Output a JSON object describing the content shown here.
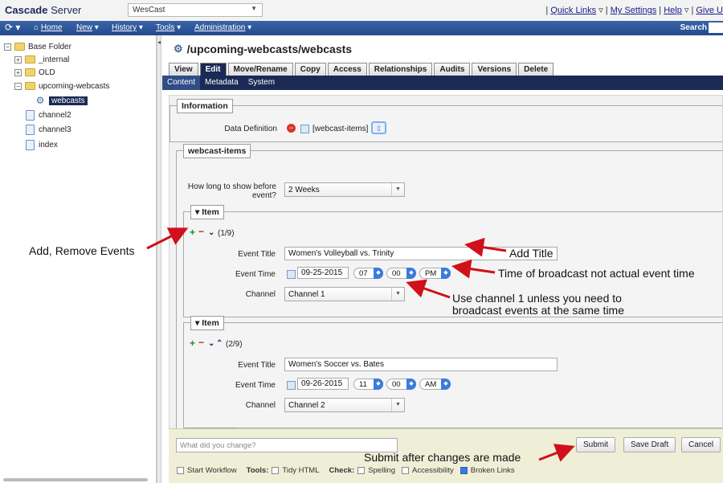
{
  "header": {
    "logo_bold": "Cascade",
    "logo_rest": " Server",
    "site": "WesCast",
    "links": {
      "sep1": "| ",
      "quick_links": "Quick Links",
      "sep2": " ▿ | ",
      "my_settings": "My Settings",
      "sep3": " | ",
      "help": "Help",
      "sep4": " ▿ | ",
      "give": "Give U"
    }
  },
  "nav": {
    "home": "Home",
    "new": "New",
    "history": "History",
    "tools": "Tools",
    "administration": "Administration",
    "search": "Search"
  },
  "tree": {
    "base_folder": "Base Folder",
    "internal": "_internal",
    "old": "OLD",
    "upcoming": "upcoming-webcasts",
    "webcasts": "webcasts",
    "channel2": "channel2",
    "channel3": "channel3",
    "index": "index"
  },
  "page": {
    "title": "/upcoming-webcasts/webcasts",
    "tabs": [
      "View",
      "Edit",
      "Move/Rename",
      "Copy",
      "Access",
      "Relationships",
      "Audits",
      "Versions",
      "Delete"
    ],
    "subtabs": [
      "Content",
      "Metadata",
      "System"
    ]
  },
  "form": {
    "information_legend": "Information",
    "data_definition_label": "Data Definition",
    "data_definition_value": "[webcast-items]",
    "webcast_items_legend": "webcast-items",
    "show_before_label_1": "How long to show before",
    "show_before_label_2": "event?",
    "show_before_value": "2 Weeks",
    "item_legend": "Item",
    "event_title_label": "Event Title",
    "event_time_label": "Event Time",
    "channel_label": "Channel",
    "items": [
      {
        "counter": "(1/9)",
        "title": "Women's Volleyball vs. Trinity",
        "date": "09-25-2015",
        "hour": "07",
        "minute": "00",
        "ampm": "PM",
        "channel": "Channel 1"
      },
      {
        "counter": "(2/9)",
        "title": "Women's Soccer vs. Bates",
        "date": "09-26-2015",
        "hour": "11",
        "minute": "00",
        "ampm": "AM",
        "channel": "Channel 2"
      }
    ]
  },
  "annotations": {
    "add_remove": "Add, Remove Events",
    "add_title": "Add Title",
    "time_note": "Time of broadcast not actual event time",
    "channel_note_1": "Use channel 1 unless you need to",
    "channel_note_2": "broadcast events at the same time",
    "submit_note": "Submit after changes are made"
  },
  "bottom": {
    "change_placeholder": "What did you change?",
    "submit": "Submit",
    "save_draft": "Save Draft",
    "cancel": "Cancel",
    "start_workflow": "Start Workflow",
    "tools_label": "Tools:",
    "tidy_html": "Tidy HTML",
    "check_label": "Check:",
    "spelling": "Spelling",
    "accessibility": "Accessibility",
    "broken_links": "Broken Links"
  },
  "colors": {
    "nav_blue": "#234a8c",
    "dark_navy": "#1b2a55",
    "annotation_red": "#d0101a",
    "add_green": "#2a8a2a"
  }
}
